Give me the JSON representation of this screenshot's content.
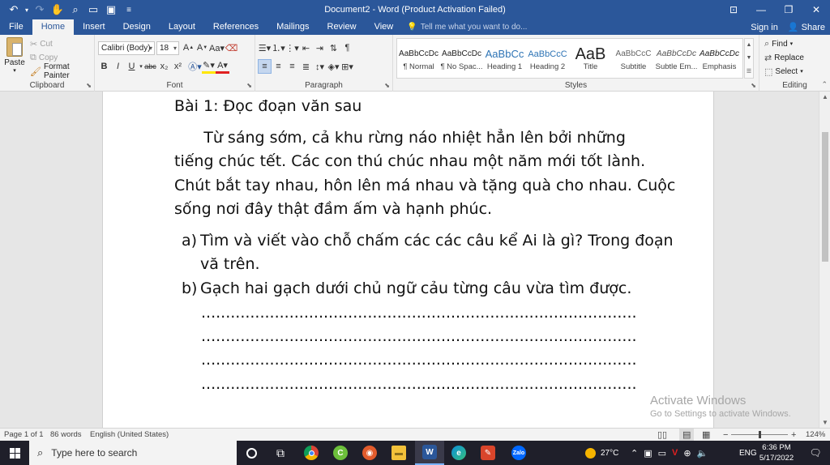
{
  "window": {
    "title": "Document2 - Word (Product Activation Failed)",
    "qat": [
      "undo-icon",
      "redo-icon",
      "touch-mode-icon",
      "print-preview-icon",
      "open-icon",
      "save-icon",
      "customize-icon"
    ]
  },
  "tabs": {
    "items": [
      "File",
      "Home",
      "Insert",
      "Design",
      "Layout",
      "References",
      "Mailings",
      "Review",
      "View"
    ],
    "active": "Home",
    "tell_me": "Tell me what you want to do...",
    "sign_in": "Sign in",
    "share": "Share"
  },
  "ribbon": {
    "clipboard": {
      "label": "Clipboard",
      "paste": "Paste",
      "cut": "Cut",
      "copy": "Copy",
      "format_painter": "Format Painter"
    },
    "font": {
      "label": "Font",
      "font_name": "Calibri (Body)",
      "font_size": "18",
      "bold": "B",
      "italic": "I",
      "underline": "U",
      "strike": "abc",
      "subscript": "x₂",
      "superscript": "x²"
    },
    "paragraph": {
      "label": "Paragraph"
    },
    "styles": {
      "label": "Styles",
      "items": [
        {
          "preview": "AaBbCcDc",
          "name": "¶ Normal"
        },
        {
          "preview": "AaBbCcDc",
          "name": "¶ No Spac..."
        },
        {
          "preview": "AaBbCc",
          "name": "Heading 1"
        },
        {
          "preview": "AaBbCcC",
          "name": "Heading 2"
        },
        {
          "preview": "AaB",
          "name": "Title"
        },
        {
          "preview": "AaBbCcC",
          "name": "Subtitle"
        },
        {
          "preview": "AaBbCcDc",
          "name": "Subtle Em..."
        },
        {
          "preview": "AaBbCcDc",
          "name": "Emphasis"
        }
      ]
    },
    "editing": {
      "label": "Editing",
      "find": "Find",
      "replace": "Replace",
      "select": "Select"
    }
  },
  "document": {
    "heading": "Bài 1: Đọc đoạn văn sau",
    "paragraph_lines": [
      "      Từ sáng sớm, cả khu rừng náo nhiệt hẳn lên bởi những",
      "tiếng chúc tết. Các con thú chúc nhau một năm mới tốt lành.",
      "Chút bắt tay nhau, hôn lên má nhau và tặng quà cho nhau. Cuộc",
      "sống nơi đây thật đầm ấm và hạnh phúc."
    ],
    "item_a_marker": "a)",
    "item_a_line1": "Tìm và viết vào chỗ chấm các các câu kể Ai là gì? Trong đoạn",
    "item_a_line2": "vă trên.",
    "item_b_marker": "b)",
    "item_b_line1": "Gạch hai gạch dưới chủ ngữ cảu từng câu vừa tìm được.",
    "dot_line": "................................................................................................................................................................"
  },
  "watermark": {
    "line1": "Activate Windows",
    "line2": "Go to Settings to activate Windows."
  },
  "status": {
    "page": "Page 1 of 1",
    "words": "86 words",
    "language": "English (United States)",
    "zoom": "124%"
  },
  "taskbar": {
    "search_placeholder": "Type here to search",
    "weather": "27°C",
    "lang": "ENG",
    "time": "6:36 PM",
    "date": "5/17/2022"
  },
  "colors": {
    "word_blue": "#2b579a",
    "ribbon_bg": "#f3f3f3",
    "taskbar_bg": "#1f1f2a"
  }
}
